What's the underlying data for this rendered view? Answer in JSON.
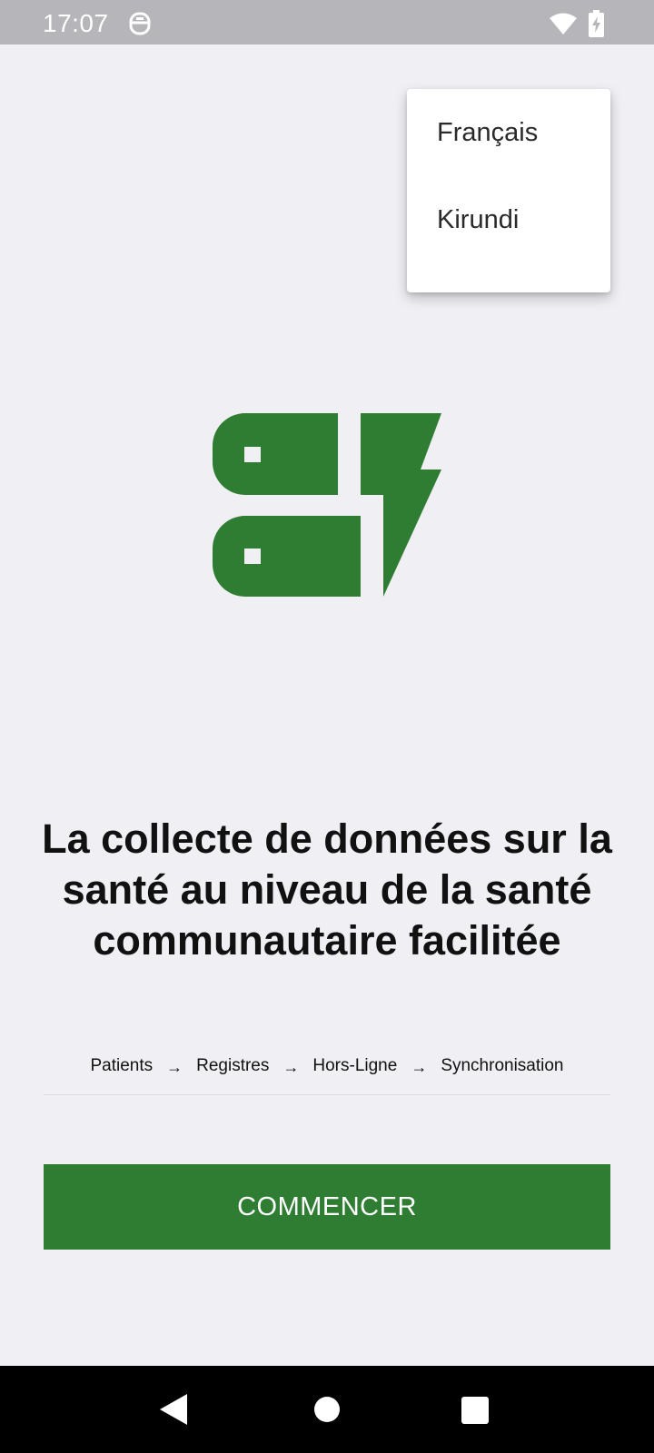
{
  "status_bar": {
    "time": "17:07",
    "icons": [
      "app-notification-icon",
      "wifi-icon",
      "battery-charging-icon"
    ]
  },
  "language_menu": {
    "items": [
      {
        "label": "Français"
      },
      {
        "label": "Kirundi"
      }
    ]
  },
  "logo": {
    "icon": "database-bolt-logo",
    "color": "#2e7d32"
  },
  "main": {
    "headline": "La collecte de données sur la santé au niveau de la santé communautaire facilitée",
    "steps": [
      "Patients",
      "Registres",
      "Hors-Ligne",
      "Synchronisation"
    ],
    "arrow": "→",
    "start_button_label": "COMMENCER"
  },
  "nav_bar": {
    "icons": [
      "back-icon",
      "home-icon",
      "recents-icon"
    ]
  },
  "colors": {
    "accent": "#2e7d32",
    "background": "#efeff4",
    "status_bar": "#b5b5ba"
  }
}
